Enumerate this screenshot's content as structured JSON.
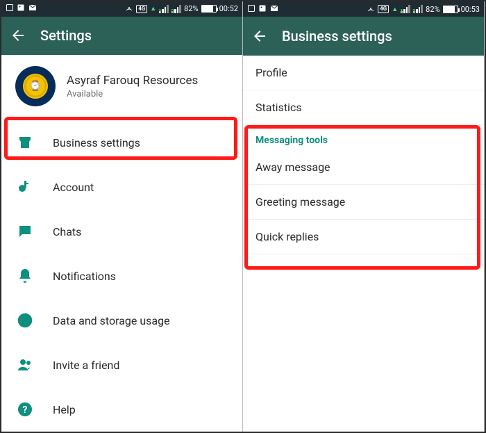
{
  "left": {
    "statusbar": {
      "network_label": "4G",
      "battery_pct": "82%",
      "clock": "00:52",
      "sim1": "1",
      "sim2": "2"
    },
    "appbar": {
      "title": "Settings"
    },
    "profile": {
      "name": "Asyraf Farouq Resources",
      "status": "Available"
    },
    "menu": [
      {
        "label": "Business settings",
        "icon": "store-icon"
      },
      {
        "label": "Account",
        "icon": "key-icon"
      },
      {
        "label": "Chats",
        "icon": "chat-icon"
      },
      {
        "label": "Notifications",
        "icon": "bell-icon"
      },
      {
        "label": "Data and storage usage",
        "icon": "data-icon"
      },
      {
        "label": "Invite a friend",
        "icon": "people-icon"
      },
      {
        "label": "Help",
        "icon": "help-icon"
      }
    ]
  },
  "right": {
    "statusbar": {
      "network_label": "4G",
      "battery_pct": "82%",
      "clock": "00:53",
      "sim1": "1",
      "sim2": "2"
    },
    "appbar": {
      "title": "Business settings"
    },
    "items_top": [
      {
        "label": "Profile"
      },
      {
        "label": "Statistics"
      }
    ],
    "section_header": "Messaging tools",
    "items_section": [
      {
        "label": "Away message"
      },
      {
        "label": "Greeting message"
      },
      {
        "label": "Quick replies"
      }
    ]
  }
}
